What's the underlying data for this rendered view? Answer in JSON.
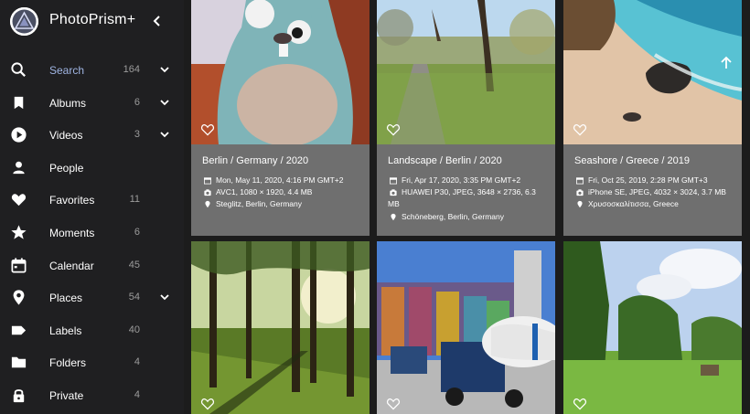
{
  "app": {
    "title": "PhotoPrism+"
  },
  "nav": {
    "items": [
      {
        "key": "search",
        "label": "Search",
        "count": "164",
        "expand": true,
        "active": true,
        "icon": "search-icon"
      },
      {
        "key": "albums",
        "label": "Albums",
        "count": "6",
        "expand": true,
        "icon": "bookmark-icon"
      },
      {
        "key": "videos",
        "label": "Videos",
        "count": "3",
        "expand": true,
        "icon": "play-circle-icon"
      },
      {
        "key": "people",
        "label": "People",
        "count": "",
        "expand": false,
        "icon": "person-icon"
      },
      {
        "key": "favorites",
        "label": "Favorites",
        "count": "11",
        "expand": false,
        "icon": "heart-icon"
      },
      {
        "key": "moments",
        "label": "Moments",
        "count": "6",
        "expand": false,
        "icon": "star-icon"
      },
      {
        "key": "calendar",
        "label": "Calendar",
        "count": "45",
        "expand": false,
        "icon": "calendar-icon"
      },
      {
        "key": "places",
        "label": "Places",
        "count": "54",
        "expand": true,
        "icon": "map-marker-icon"
      },
      {
        "key": "labels",
        "label": "Labels",
        "count": "40",
        "expand": false,
        "icon": "label-icon"
      },
      {
        "key": "folders",
        "label": "Folders",
        "count": "4",
        "expand": false,
        "icon": "folder-icon"
      },
      {
        "key": "private",
        "label": "Private",
        "count": "4",
        "expand": false,
        "icon": "lock-icon"
      }
    ]
  },
  "cards": [
    {
      "title": "Berlin / Germany / 2020",
      "date": "Mon, May 11, 2020, 4:16 PM GMT+2",
      "camera": "AVC1, 1080 × 1920, 4.4 MB",
      "location": "Steglitz, Berlin, Germany"
    },
    {
      "title": "Landscape / Berlin / 2020",
      "date": "Fri, Apr 17, 2020, 3:35 PM GMT+2",
      "camera": "HUAWEI P30, JPEG, 3648 × 2736, 6.3",
      "camera2": "MB",
      "location": "Schöneberg, Berlin, Germany"
    },
    {
      "title": "Seashore / Greece / 2019",
      "date": "Fri, Oct 25, 2019, 2:28 PM GMT+3",
      "camera": "iPhone SE, JPEG, 4032 × 3024, 3.7 MB",
      "location": "Χρυσοσκαλίτισσα, Greece"
    }
  ],
  "colors": {
    "sidebar": "#1f1f21",
    "card": "#6f6f6f",
    "accent": "#9fb4e2"
  }
}
